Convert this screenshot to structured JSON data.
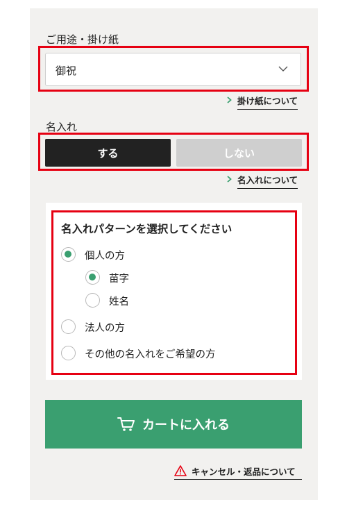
{
  "usage": {
    "label": "ご用途・掛け紙",
    "selected": "御祝",
    "link": "掛け紙について"
  },
  "naire": {
    "label": "名入れ",
    "on": "する",
    "off": "しない",
    "link": "名入れについて"
  },
  "pattern": {
    "title": "名入れパターンを選択してください",
    "options": [
      {
        "label": "個人の方",
        "checked": true
      },
      {
        "label": "苗字",
        "checked": true
      },
      {
        "label": "姓名",
        "checked": false
      },
      {
        "label": "法人の方",
        "checked": false
      },
      {
        "label": "その他の名入れをご希望の方",
        "checked": false
      }
    ]
  },
  "cart": {
    "label": "カートに入れる"
  },
  "cancel": {
    "label": "キャンセル・返品について"
  },
  "colors": {
    "accent": "#3a9f70",
    "highlight": "#e60012",
    "dark": "#222222"
  }
}
